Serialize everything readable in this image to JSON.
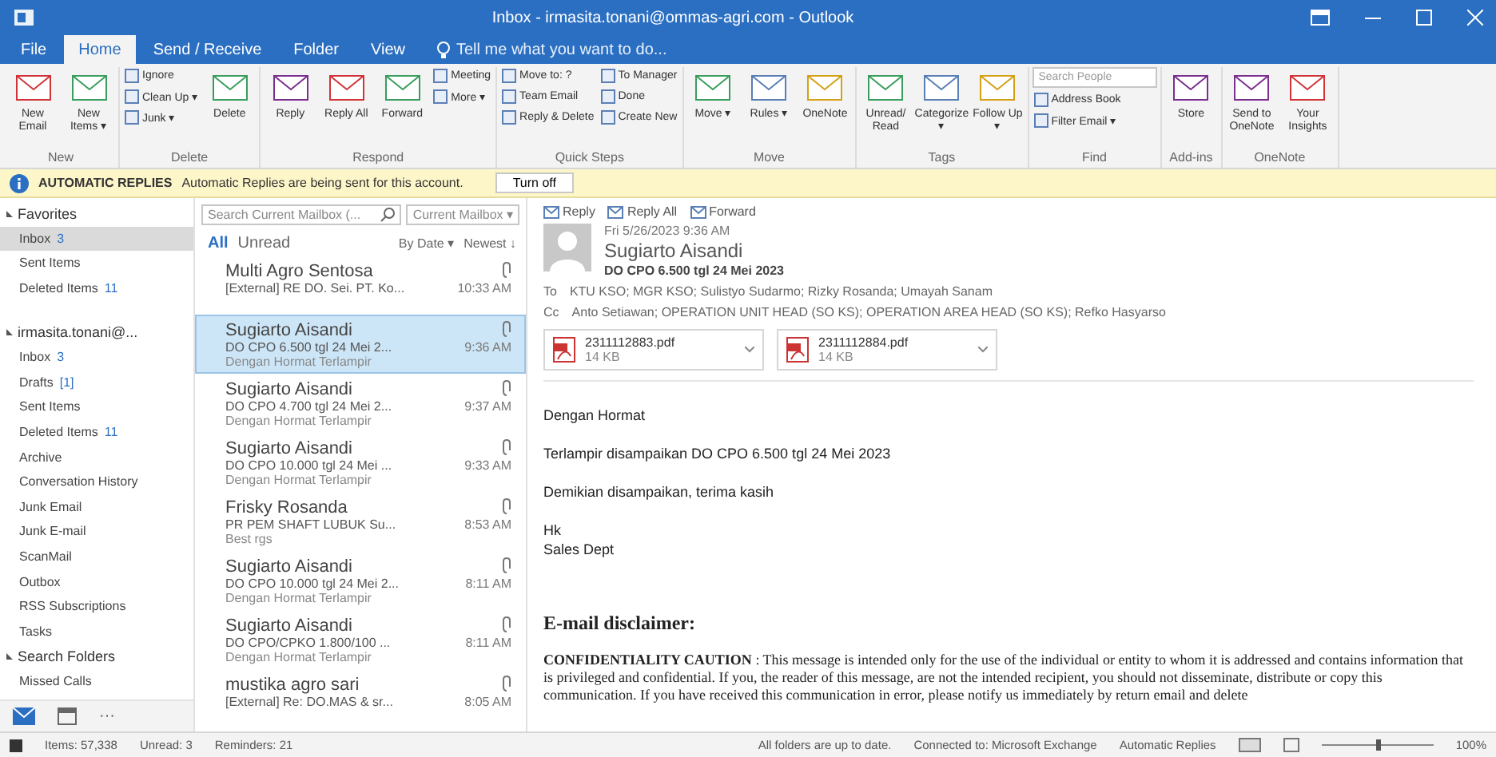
{
  "window": {
    "title": "Inbox - irmasita.tonani@ommas-agri.com - Outlook"
  },
  "tabs": [
    {
      "label": "File",
      "selected": false
    },
    {
      "label": "Home",
      "selected": true
    },
    {
      "label": "Send / Receive",
      "selected": false
    },
    {
      "label": "Folder",
      "selected": false
    },
    {
      "label": "View",
      "selected": false
    }
  ],
  "tell_me": {
    "placeholder": "Tell me what you want to do..."
  },
  "ribbon": [
    {
      "label": "New",
      "buttons": [
        {
          "kind": "large",
          "label": "New Email"
        },
        {
          "kind": "large",
          "label": "New Items ▾"
        }
      ]
    },
    {
      "label": "Delete",
      "buttons": [
        {
          "kind": "small",
          "label": "Ignore"
        },
        {
          "kind": "small",
          "label": "Clean Up ▾"
        },
        {
          "kind": "small",
          "label": "Junk ▾"
        },
        {
          "kind": "large",
          "label": "Delete"
        }
      ]
    },
    {
      "label": "Respond",
      "buttons": [
        {
          "kind": "large",
          "label": "Reply"
        },
        {
          "kind": "large",
          "label": "Reply All"
        },
        {
          "kind": "large",
          "label": "Forward"
        },
        {
          "kind": "small",
          "label": "Meeting"
        },
        {
          "kind": "small",
          "label": "More ▾"
        }
      ]
    },
    {
      "label": "Quick Steps",
      "buttons": [
        {
          "kind": "small",
          "label": "Move to: ?"
        },
        {
          "kind": "small",
          "label": "Team Email"
        },
        {
          "kind": "small",
          "label": "Reply & Delete"
        },
        {
          "kind": "small",
          "label": "To Manager"
        },
        {
          "kind": "small",
          "label": "Done"
        },
        {
          "kind": "small",
          "label": "Create New"
        }
      ]
    },
    {
      "label": "Move",
      "buttons": [
        {
          "kind": "large",
          "label": "Move ▾"
        },
        {
          "kind": "large",
          "label": "Rules ▾"
        },
        {
          "kind": "large",
          "label": "OneNote"
        }
      ]
    },
    {
      "label": "Tags",
      "buttons": [
        {
          "kind": "large",
          "label": "Unread/ Read"
        },
        {
          "kind": "large",
          "label": "Categorize ▾"
        },
        {
          "kind": "large",
          "label": "Follow Up ▾"
        }
      ]
    },
    {
      "label": "Find",
      "buttons": [
        {
          "kind": "field",
          "label": "Search People"
        },
        {
          "kind": "small",
          "label": "Address Book"
        },
        {
          "kind": "small",
          "label": "Filter Email ▾"
        }
      ]
    },
    {
      "label": "Add-ins",
      "buttons": [
        {
          "kind": "large",
          "label": "Store"
        }
      ]
    },
    {
      "label": "OneNote",
      "buttons": [
        {
          "kind": "large",
          "label": "Send to OneNote"
        },
        {
          "kind": "large",
          "label": "Your Insights"
        }
      ]
    }
  ],
  "info_bar": {
    "title": "AUTOMATIC REPLIES",
    "message": "Automatic Replies are being sent for this account.",
    "button": "Turn off"
  },
  "folders": [
    {
      "kind": "header",
      "label": "Favorites",
      "expanded": true
    },
    {
      "kind": "folder",
      "label": "Inbox",
      "count": "3",
      "selected": true
    },
    {
      "kind": "folder",
      "label": "Sent Items",
      "selected": false
    },
    {
      "kind": "folder",
      "label": "Deleted Items",
      "count": "11",
      "selected": false
    },
    {
      "kind": "gap"
    },
    {
      "kind": "header",
      "label": "irmasita.tonani@...",
      "expanded": true
    },
    {
      "kind": "folder",
      "label": "Inbox",
      "count": "3",
      "selected": false
    },
    {
      "kind": "folder",
      "label": "Drafts",
      "count": "[1]",
      "selected": false
    },
    {
      "kind": "folder",
      "label": "Sent Items",
      "selected": false
    },
    {
      "kind": "folder",
      "label": "Deleted Items",
      "count": "11",
      "selected": false
    },
    {
      "kind": "folder",
      "label": "Archive",
      "selected": false
    },
    {
      "kind": "folder",
      "label": "Conversation History",
      "selected": false
    },
    {
      "kind": "folder",
      "label": "Junk Email",
      "selected": false
    },
    {
      "kind": "folder",
      "label": "Junk E-mail",
      "selected": false
    },
    {
      "kind": "folder",
      "label": "ScanMail",
      "selected": false
    },
    {
      "kind": "folder",
      "label": "Outbox",
      "selected": false
    },
    {
      "kind": "folder",
      "label": "RSS Subscriptions",
      "selected": false
    },
    {
      "kind": "folder",
      "label": "Tasks",
      "selected": false
    },
    {
      "kind": "header",
      "label": "Search Folders",
      "expanded": true
    },
    {
      "kind": "folder",
      "label": "Missed Calls",
      "selected": false
    }
  ],
  "nav": {
    "more": "···"
  },
  "message_list": {
    "search_placeholder": "Search Current Mailbox (...",
    "scope": "Current Mailbox ▾",
    "filters": [
      {
        "label": "All",
        "selected": true
      },
      {
        "label": "Unread",
        "selected": false
      }
    ],
    "sort": "By Date ▾",
    "order": "Newest ↓",
    "messages": [
      {
        "sender": "Multi Agro Sentosa",
        "subject": "[External] RE DO. Sei. PT. Ko...",
        "time": "10:33 AM",
        "selected": false
      },
      {
        "sender": "Sugiarto Aisandi",
        "subject": "DO CPO 6.500 tgl 24 Mei 2...",
        "time": "9:36 AM",
        "preview": "Dengan Hormat Terlampir",
        "selected": true
      },
      {
        "sender": "Sugiarto Aisandi",
        "subject": "DO CPO 4.700 tgl 24 Mei 2...",
        "time": "9:37 AM",
        "preview": "Dengan Hormat Terlampir",
        "selected": false
      },
      {
        "sender": "Sugiarto Aisandi",
        "subject": "DO CPO 10.000 tgl 24 Mei ...",
        "time": "9:33 AM",
        "preview": "Dengan Hormat Terlampir",
        "selected": false
      },
      {
        "sender": "Frisky Rosanda",
        "subject": "PR PEM SHAFT LUBUK Su...",
        "time": "8:53 AM",
        "preview": "Best rgs",
        "selected": false
      },
      {
        "sender": "Sugiarto Aisandi",
        "subject": "DO CPO 10.000 tgl 24 Mei 2...",
        "time": "8:11 AM",
        "preview": "Dengan Hormat Terlampir",
        "selected": false
      },
      {
        "sender": "Sugiarto Aisandi",
        "subject": "DO CPO/CPKO 1.800/100 ...",
        "time": "8:11 AM",
        "preview": "Dengan Hormat Terlampir",
        "selected": false
      },
      {
        "sender": "mustika agro sari",
        "subject": "[External] Re: DO.MAS & sr...",
        "time": "8:05 AM",
        "selected": false
      }
    ]
  },
  "reading_pane": {
    "actions": [
      "Reply",
      "Reply All",
      "Forward"
    ],
    "date": "Fri 5/26/2023 9:36 AM",
    "sender": "Sugiarto Aisandi",
    "subject": "DO CPO 6.500  tgl 24 Mei 2023",
    "to_label": "To",
    "to": "KTU KSO; MGR KSO; Sulistyo Sudarmo; Rizky Rosanda; Umayah Sanam",
    "cc_label": "Cc",
    "cc": "Anto Setiawan; OPERATION UNIT HEAD (SO KS); OPERATION AREA HEAD (SO KS); Refko Hasyarso",
    "attachments": [
      {
        "name": "2311112883.pdf",
        "size": "14 KB"
      },
      {
        "name": "2311112884.pdf",
        "size": "14 KB"
      }
    ],
    "body": [
      "Dengan Hormat",
      "Terlampir disampaikan DO CPO 6.500  tgl 24 Mei 2023",
      "Demikian disampaikan, terima kasih"
    ],
    "signature": [
      "Hk",
      "Sales Dept"
    ],
    "disclaimer_title": "E-mail disclaimer:",
    "disclaimer": "**CONFIDENTIALITY CAUTION** : This message is intended only for the use of the individual or entity to whom it is addressed and contains information that is privileged and confidential. If you, the reader of this message, are not the intended recipient, you should not disseminate, distribute or copy this communication. If you have received this communication in error, please notify us immediately by return email and delete"
  },
  "status_bar": {
    "items": [
      "Items: 57,338",
      "Unread: 3",
      "Reminders: 21"
    ],
    "right": [
      "All folders are up to date.",
      "Connected to: Microsoft Exchange",
      "Automatic Replies"
    ],
    "zoom": {
      "level": 0.5,
      "reading": "100%"
    }
  }
}
